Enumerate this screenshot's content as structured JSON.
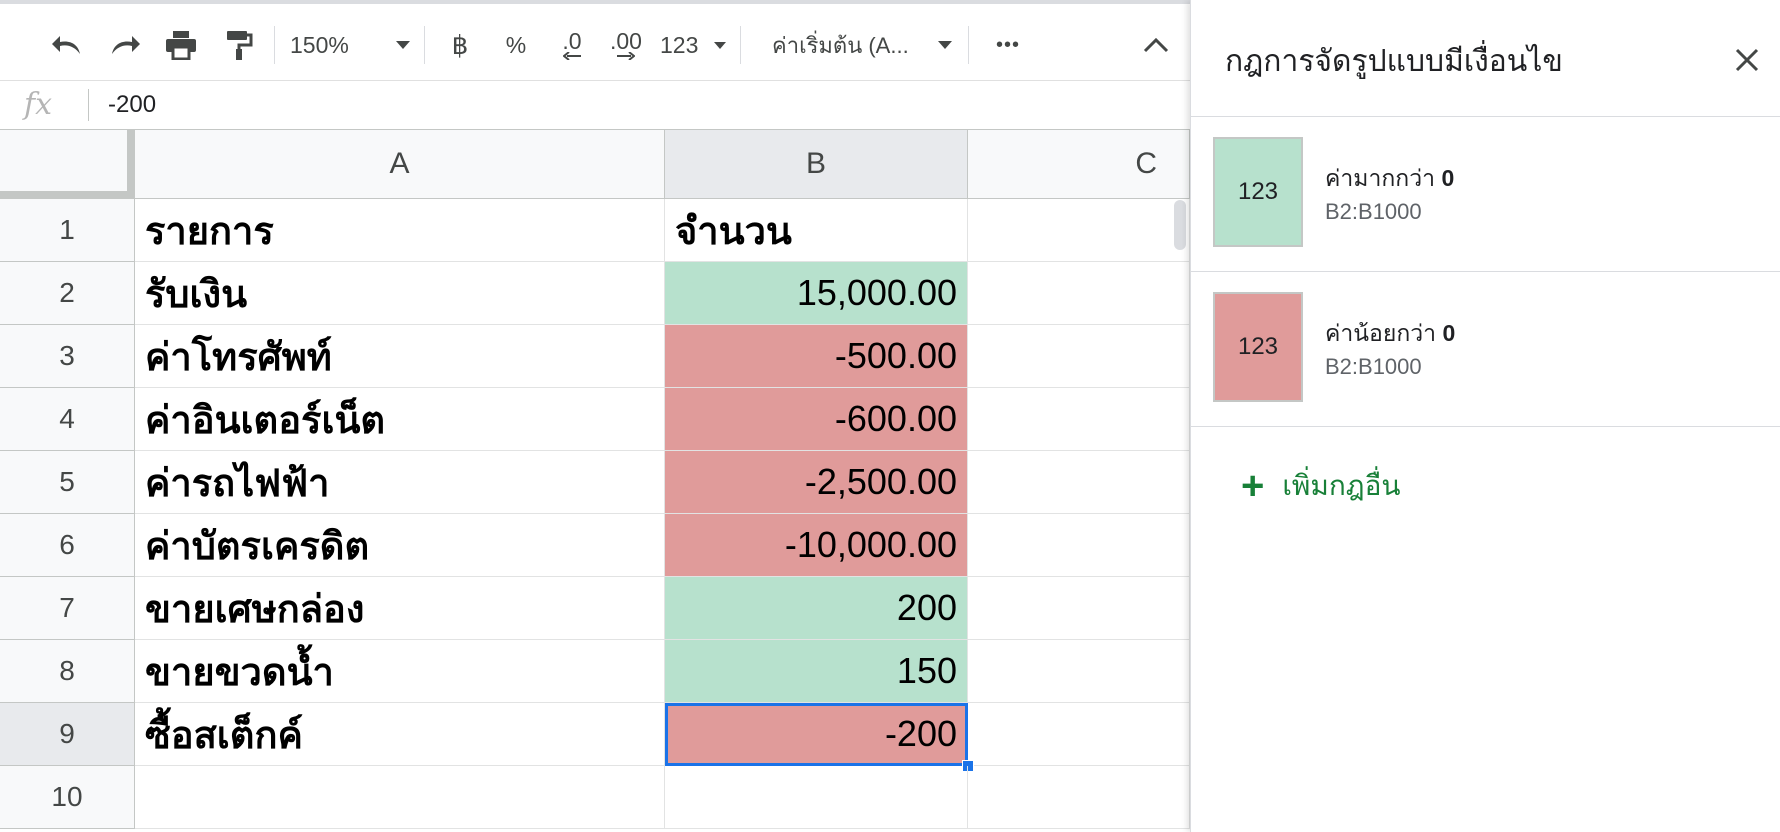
{
  "toolbar": {
    "zoom": "150%",
    "currency_symbol": "฿",
    "percent_symbol": "%",
    "decrease_decimal": ".0",
    "increase_decimal": ".00",
    "more_formats": "123",
    "font_name": "ค่าเริ่มต้น (A...",
    "more_label": "•••"
  },
  "formula_bar": {
    "fx_label": "fx",
    "value": "-200"
  },
  "sheet": {
    "columns": [
      "A",
      "B",
      "C"
    ],
    "rows": [
      {
        "num": "1",
        "a": "รายการ",
        "b": "จำนวน",
        "fill": ""
      },
      {
        "num": "2",
        "a": "รับเงิน",
        "b": "15,000.00",
        "fill": "green"
      },
      {
        "num": "3",
        "a": "ค่าโทรศัพท์",
        "b": "-500.00",
        "fill": "red"
      },
      {
        "num": "4",
        "a": "ค่าอินเตอร์เน็ต",
        "b": "-600.00",
        "fill": "red"
      },
      {
        "num": "5",
        "a": "ค่ารถไฟฟ้า",
        "b": "-2,500.00",
        "fill": "red"
      },
      {
        "num": "6",
        "a": "ค่าบัตรเครดิต",
        "b": "-10,000.00",
        "fill": "red"
      },
      {
        "num": "7",
        "a": "ขายเศษกล่อง",
        "b": "200",
        "fill": "green"
      },
      {
        "num": "8",
        "a": "ขายขวดน้ำ",
        "b": "150",
        "fill": "green"
      },
      {
        "num": "9",
        "a": "ซื้อสเต็กค์",
        "b": "-200",
        "fill": "red"
      },
      {
        "num": "10",
        "a": "",
        "b": "",
        "fill": ""
      }
    ],
    "selected_cell": "B9"
  },
  "colors": {
    "green_fill": "#b7e1cd",
    "red_fill": "#e09b9a",
    "selection": "#1a73e8",
    "add_rule": "#188038"
  },
  "panel": {
    "title": "กฎการจัดรูปแบบมีเงื่อนไข",
    "rules": [
      {
        "swatch_text": "123",
        "condition": "ค่ามากกว่า",
        "value": "0",
        "range": "B2:B1000",
        "color": "#b7e1cd"
      },
      {
        "swatch_text": "123",
        "condition": "ค่าน้อยกว่า",
        "value": "0",
        "range": "B2:B1000",
        "color": "#e09b9a"
      }
    ],
    "add_rule_label": "เพิ่มกฎอื่น"
  }
}
